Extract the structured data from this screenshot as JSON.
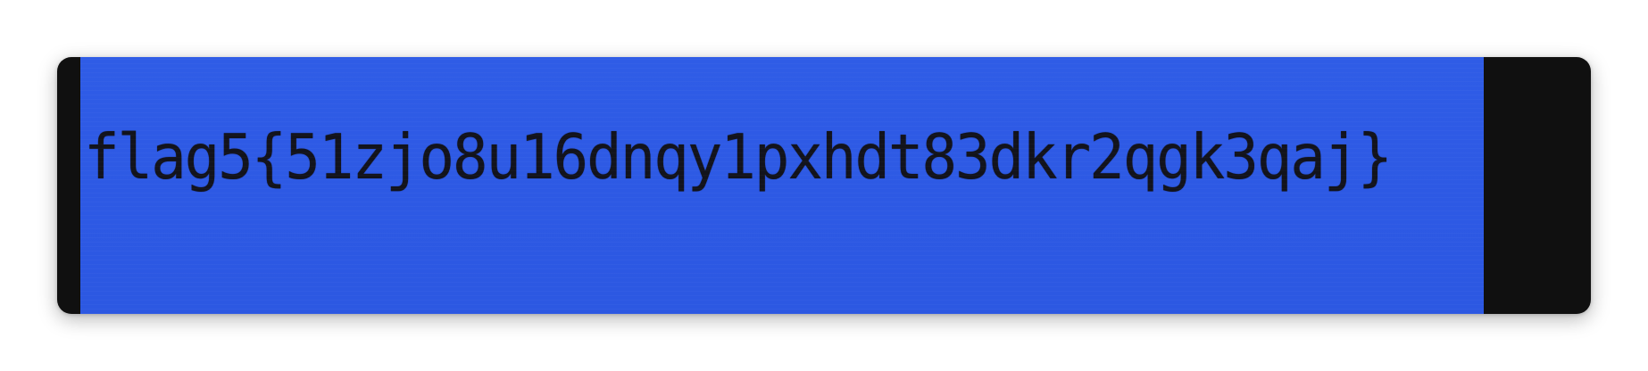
{
  "screen": {
    "text": "flag5{51zjo8u16dnqy1pxhdt83dkr2qgk3qaj}",
    "background_color": "#2d59e4",
    "text_color": "#12131c",
    "frame_color": "#101010"
  }
}
